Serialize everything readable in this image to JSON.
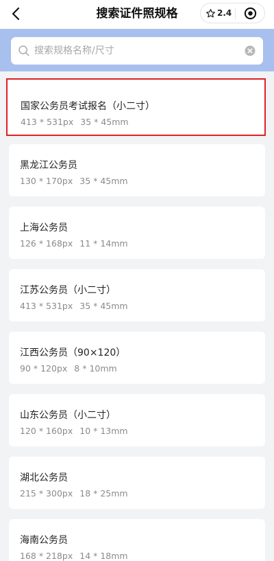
{
  "header": {
    "title": "搜索证件照规格",
    "rating": "2.4",
    "back_icon": "chevron-left-icon",
    "star_icon": "star-outline-icon",
    "target_icon": "target-circle-icon"
  },
  "search": {
    "placeholder": "搜索规格名称/尺寸",
    "value": ""
  },
  "colors": {
    "search_band": "#a8c0ee",
    "selected_border": "#e02020",
    "background": "#f2f3f5"
  },
  "specs": [
    {
      "name": "国家公务员考试报名（小二寸）",
      "px": "413 * 531px",
      "mm": "35 * 45mm",
      "selected": true
    },
    {
      "name": "黑龙江公务员",
      "px": "130 * 170px",
      "mm": "35 * 45mm",
      "selected": false
    },
    {
      "name": "上海公务员",
      "px": "126 * 168px",
      "mm": "11 * 14mm",
      "selected": false
    },
    {
      "name": "江苏公务员（小二寸）",
      "px": "413 * 531px",
      "mm": "35 * 45mm",
      "selected": false
    },
    {
      "name": "江西公务员（90×120）",
      "px": "90 * 120px",
      "mm": "8 * 10mm",
      "selected": false
    },
    {
      "name": "山东公务员（小二寸）",
      "px": "120 * 160px",
      "mm": "10 * 13mm",
      "selected": false
    },
    {
      "name": "湖北公务员",
      "px": "215 * 300px",
      "mm": "18 * 25mm",
      "selected": false
    },
    {
      "name": "海南公务员",
      "px": "168 * 218px",
      "mm": "14 * 18mm",
      "selected": false
    }
  ]
}
